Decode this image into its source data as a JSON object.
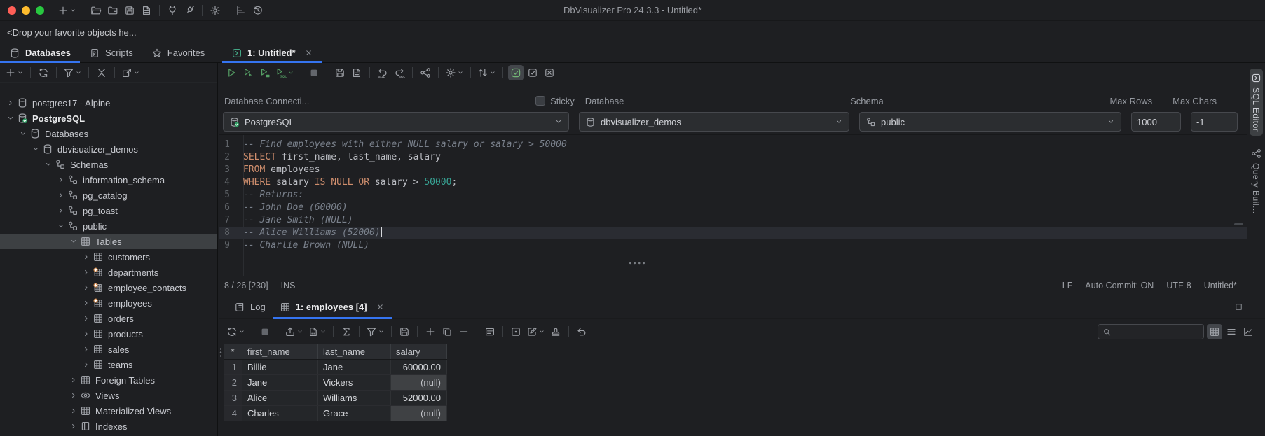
{
  "colors": {
    "accent_blue": "#3574f0",
    "keyword_orange": "#cf8e6d",
    "number_teal": "#37a394",
    "comment_gray": "#7a818c",
    "run_green": "#55a065",
    "tab_icon_teal": "#43a685",
    "selection_gray": "#3d4043",
    "null_cell_bg": "#3f4144",
    "traffic_red": "#ff5f57",
    "traffic_yellow": "#febc2e",
    "traffic_green": "#28c840"
  },
  "titlebar": {
    "title": "DbVisualizer Pro 24.3.3 - Untitled*",
    "icons": [
      {
        "name": "new-tab-button",
        "icon": "plus",
        "chevron": true
      },
      "|",
      {
        "name": "open-file-button",
        "icon": "folder-open"
      },
      {
        "name": "close-file-button",
        "icon": "folder-x"
      },
      {
        "name": "save-button",
        "icon": "save"
      },
      {
        "name": "save-as-button",
        "icon": "save-doc"
      },
      "|",
      {
        "name": "connect-button",
        "icon": "plug"
      },
      {
        "name": "disconnect-button",
        "icon": "plug-off"
      },
      "|",
      {
        "name": "tool-properties-button",
        "icon": "gear"
      },
      "|",
      {
        "name": "sql-monitor-button",
        "icon": "levels"
      },
      {
        "name": "history-button",
        "icon": "history"
      }
    ]
  },
  "drop_hint": "<Drop your favorite objects he...",
  "nav_tabs": [
    {
      "label": "Databases",
      "icon": "db",
      "active": true
    },
    {
      "label": "Scripts",
      "icon": "script"
    },
    {
      "label": "Favorites",
      "icon": "star"
    }
  ],
  "editor_tab": {
    "label": "1: Untitled*",
    "icon": "sqltab",
    "active": true,
    "closable": true,
    "icon_teal": true
  },
  "sidebar": {
    "toolbar": [
      {
        "name": "create-connection-button",
        "icon": "plus",
        "chevron": true
      },
      "|",
      {
        "name": "refresh-objects-button",
        "icon": "refresh"
      },
      "|",
      {
        "name": "filter-connections-button",
        "icon": "filter",
        "chevron": true
      },
      "|",
      {
        "name": "collapse-all-button",
        "icon": "collapse"
      },
      "|",
      {
        "name": "open-object-button",
        "icon": "window",
        "chevron": true
      }
    ],
    "tree": [
      {
        "depth": 0,
        "chevron": "collapsed",
        "icon": "db",
        "label": "postgres17 - Alpine"
      },
      {
        "depth": 0,
        "chevron": "expanded",
        "icon": "db-check",
        "label": "PostgreSQL",
        "bold": true
      },
      {
        "depth": 1,
        "chevron": "expanded",
        "icon": "db",
        "label": "Databases"
      },
      {
        "depth": 2,
        "chevron": "expanded",
        "icon": "db",
        "label": "dbvisualizer_demos"
      },
      {
        "depth": 3,
        "chevron": "expanded",
        "icon": "schema",
        "label": "Schemas"
      },
      {
        "depth": 4,
        "chevron": "collapsed",
        "icon": "schema",
        "label": "information_schema"
      },
      {
        "depth": 4,
        "chevron": "collapsed",
        "icon": "schema",
        "label": "pg_catalog"
      },
      {
        "depth": 4,
        "chevron": "collapsed",
        "icon": "schema",
        "label": "pg_toast"
      },
      {
        "depth": 4,
        "chevron": "expanded",
        "icon": "schema",
        "label": "public"
      },
      {
        "depth": 5,
        "chevron": "expanded",
        "icon": "grid3",
        "label": "Tables",
        "selected": true
      },
      {
        "depth": 6,
        "chevron": "collapsed",
        "icon": "grid3",
        "label": "customers"
      },
      {
        "depth": 6,
        "chevron": "collapsed",
        "icon": "tableplus",
        "label": "departments"
      },
      {
        "depth": 6,
        "chevron": "collapsed",
        "icon": "tableplus",
        "label": "employee_contacts"
      },
      {
        "depth": 6,
        "chevron": "collapsed",
        "icon": "tableplus",
        "label": "employees"
      },
      {
        "depth": 6,
        "chevron": "collapsed",
        "icon": "grid3",
        "label": "orders"
      },
      {
        "depth": 6,
        "chevron": "collapsed",
        "icon": "grid3",
        "label": "products"
      },
      {
        "depth": 6,
        "chevron": "collapsed",
        "icon": "grid3",
        "label": "sales"
      },
      {
        "depth": 6,
        "chevron": "collapsed",
        "icon": "grid3",
        "label": "teams"
      },
      {
        "depth": 5,
        "chevron": "collapsed",
        "icon": "grid3",
        "label": "Foreign Tables"
      },
      {
        "depth": 5,
        "chevron": "collapsed",
        "icon": "eye",
        "label": "Views"
      },
      {
        "depth": 5,
        "chevron": "collapsed",
        "icon": "grid3",
        "label": "Materialized Views"
      },
      {
        "depth": 5,
        "chevron": "collapsed",
        "icon": "index",
        "label": "Indexes"
      }
    ]
  },
  "sql_editor": {
    "toolbar": [
      {
        "name": "execute-button",
        "icon": "play",
        "cls": "green"
      },
      {
        "name": "execute-current-button",
        "icon": "play-cursor",
        "cls": "green"
      },
      {
        "name": "execute-script-button",
        "icon": "play-script",
        "cls": "green"
      },
      {
        "name": "execute-explain-button",
        "icon": "play-sql",
        "cls": "green",
        "chevron": true
      },
      "|",
      {
        "name": "stop-button",
        "icon": "stop",
        "cls": "dim"
      },
      "|",
      {
        "name": "save-button",
        "icon": "save"
      },
      {
        "name": "save-as-button",
        "icon": "save-doc"
      },
      "|",
      {
        "name": "undo-sql-button",
        "icon": "undo-sql"
      },
      {
        "name": "redo-sql-button",
        "icon": "redo-sql"
      },
      "|",
      {
        "name": "visualize-query-button",
        "icon": "share"
      },
      "|",
      {
        "name": "editor-settings-button",
        "icon": "gear",
        "chevron": true
      },
      "|",
      {
        "name": "format-sql-button",
        "icon": "sort",
        "chevron": true
      },
      "|",
      {
        "name": "auto-commit-toggle",
        "icon": "togglecheck",
        "active": true,
        "cls": "greenish"
      },
      {
        "name": "confirm-execute-toggle",
        "icon": "checkbox"
      },
      {
        "name": "clear-results-toggle",
        "icon": "xbox"
      }
    ],
    "connection": {
      "label": "Database Connecti...",
      "value": "PostgreSQL"
    },
    "sticky_label": "Sticky",
    "database": {
      "label": "Database",
      "value": "dbvisualizer_demos"
    },
    "schema": {
      "label": "Schema",
      "value": "public"
    },
    "max_rows": {
      "label": "Max Rows",
      "value": "1000"
    },
    "max_chars": {
      "label": "Max Chars",
      "value": "-1"
    },
    "lines": [
      {
        "n": 1,
        "tokens": [
          [
            "c",
            "-- Find employees with either NULL salary or salary > 50000"
          ]
        ]
      },
      {
        "n": 2,
        "tokens": [
          [
            "k",
            "SELECT"
          ],
          [
            "p",
            " first_name, last_name, salary"
          ]
        ]
      },
      {
        "n": 3,
        "tokens": [
          [
            "k",
            "FROM"
          ],
          [
            "p",
            " employees"
          ]
        ]
      },
      {
        "n": 4,
        "tokens": [
          [
            "k",
            "WHERE"
          ],
          [
            "p",
            " salary "
          ],
          [
            "k",
            "IS"
          ],
          [
            "p",
            " "
          ],
          [
            "k",
            "NULL"
          ],
          [
            "p",
            " "
          ],
          [
            "k",
            "OR"
          ],
          [
            "p",
            " salary > "
          ],
          [
            "nm",
            "50000"
          ],
          [
            "p",
            ";"
          ]
        ]
      },
      {
        "n": 5,
        "tokens": [
          [
            "c",
            "-- Returns:"
          ]
        ]
      },
      {
        "n": 6,
        "tokens": [
          [
            "c",
            "-- John Doe (60000)"
          ]
        ]
      },
      {
        "n": 7,
        "tokens": [
          [
            "c",
            "-- Jane Smith (NULL)"
          ]
        ]
      },
      {
        "n": 8,
        "tokens": [
          [
            "c",
            "-- Alice Williams (52000)"
          ]
        ],
        "current": true,
        "caret": true
      },
      {
        "n": 9,
        "tokens": [
          [
            "c",
            "-- Charlie Brown (NULL)"
          ]
        ]
      }
    ],
    "status_left": [
      "8 / 26 [230]",
      "INS"
    ],
    "status_right": [
      "LF",
      "Auto Commit: ON",
      "UTF-8",
      "Untitled*"
    ]
  },
  "side_strip": [
    {
      "label": "SQL Editor",
      "icon": "sqltab",
      "active": true
    },
    {
      "label": "Query Buil...",
      "icon": "share"
    }
  ],
  "results": {
    "tabs": [
      {
        "label": "Log",
        "icon": "scroll"
      },
      {
        "label": "1: employees [4]",
        "icon": "grid3",
        "active": true,
        "closable": true
      }
    ],
    "toolbar": [
      {
        "name": "reload-grid-button",
        "icon": "refresh",
        "chevron": true
      },
      "|",
      {
        "name": "stop-grid-button",
        "icon": "stop",
        "cls": "dim"
      },
      "|",
      {
        "name": "export-grid-button",
        "icon": "export",
        "chevron": true
      },
      {
        "name": "compare-grid-button",
        "icon": "docx",
        "chevron": true
      },
      "|",
      {
        "name": "aggregate-button",
        "icon": "sigma"
      },
      "|",
      {
        "name": "filter-grid-button",
        "icon": "filter",
        "chevron": true
      },
      "|",
      {
        "name": "save-grid-button",
        "icon": "save"
      },
      "|",
      {
        "name": "insert-row-button",
        "icon": "plus"
      },
      {
        "name": "duplicate-row-button",
        "icon": "copy"
      },
      {
        "name": "delete-row-button",
        "icon": "minus"
      },
      "|",
      {
        "name": "form-view-button",
        "icon": "form"
      },
      "|",
      {
        "name": "cell-viewer-button",
        "icon": "dotbox"
      },
      {
        "name": "edit-mode-button",
        "icon": "pencil",
        "chevron": true
      },
      {
        "name": "batch-update-button",
        "icon": "stamp"
      },
      "|",
      {
        "name": "undo-edit-button",
        "icon": "undo"
      }
    ],
    "view_toggles": [
      {
        "name": "grid-view-toggle",
        "icon": "grid3",
        "active": true
      },
      {
        "name": "text-view-toggle",
        "icon": "rows"
      },
      {
        "name": "chart-view-toggle",
        "icon": "chartline"
      }
    ],
    "corner": "*",
    "columns": [
      "first_name",
      "last_name",
      "salary"
    ],
    "rows": [
      {
        "num": "1",
        "cells": [
          "Billie",
          "Jane",
          "60000.00"
        ],
        "null_cols": []
      },
      {
        "num": "2",
        "cells": [
          "Jane",
          "Vickers",
          "(null)"
        ],
        "null_cols": [
          2
        ]
      },
      {
        "num": "3",
        "cells": [
          "Alice",
          "Williams",
          "52000.00"
        ],
        "null_cols": []
      },
      {
        "num": "4",
        "cells": [
          "Charles",
          "Grace",
          "(null)"
        ],
        "null_cols": [
          2
        ]
      }
    ]
  }
}
